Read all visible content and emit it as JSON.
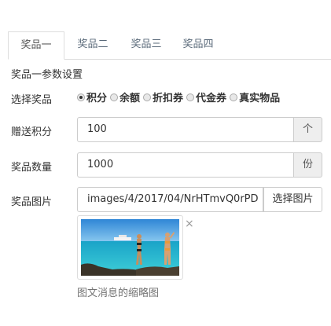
{
  "tabs": [
    {
      "label": "奖品一",
      "active": true
    },
    {
      "label": "奖品二",
      "active": false
    },
    {
      "label": "奖品三",
      "active": false
    },
    {
      "label": "奖品四",
      "active": false
    }
  ],
  "section_title": "奖品一参数设置",
  "prize_type": {
    "label": "选择奖品",
    "options": [
      "积分",
      "余额",
      "折扣券",
      "代金券",
      "真实物品"
    ],
    "selected": "积分"
  },
  "points": {
    "label": "赠送积分",
    "value": "100",
    "unit": "个"
  },
  "quantity": {
    "label": "奖品数量",
    "value": "1000",
    "unit": "份"
  },
  "image": {
    "label": "奖品图片",
    "path": "images/4/2017/04/NrHTmvQ0rPD",
    "select_button": "选择图片",
    "close_glyph": "×",
    "help": "图文消息的缩略图"
  }
}
